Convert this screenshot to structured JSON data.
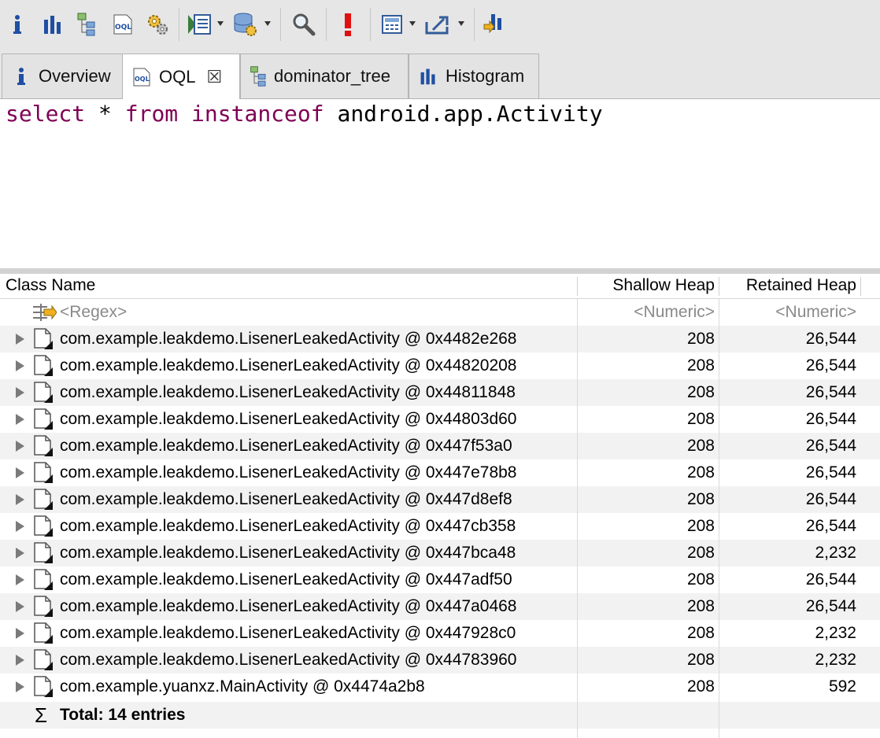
{
  "toolbar": {
    "buttons": [
      {
        "name": "info-icon",
        "dropdown": false
      },
      {
        "name": "histogram-icon",
        "dropdown": false
      },
      {
        "name": "dominator-tree-icon",
        "dropdown": false
      },
      {
        "name": "oql-icon",
        "dropdown": false
      },
      {
        "name": "gears-icon",
        "dropdown": false
      },
      {
        "name": "report-icon",
        "dropdown": true
      },
      {
        "name": "database-query-icon",
        "dropdown": true
      },
      {
        "name": "search-icon",
        "dropdown": false
      },
      {
        "name": "alert-icon",
        "dropdown": false
      },
      {
        "name": "calculator-icon",
        "dropdown": true
      },
      {
        "name": "export-icon",
        "dropdown": true
      },
      {
        "name": "heap-dump-icon",
        "dropdown": false
      }
    ],
    "oql_icon_text": "OQL"
  },
  "tabs": [
    {
      "label": "Overview",
      "icon": "info-icon",
      "active": false
    },
    {
      "label": "OQL",
      "icon": "oql-icon",
      "active": true,
      "close": "☒"
    },
    {
      "label": "dominator_tree",
      "icon": "dominator-tree-icon",
      "active": false
    },
    {
      "label": "Histogram",
      "icon": "histogram-icon",
      "active": false
    }
  ],
  "query": {
    "kw1": "select",
    "p1": " * ",
    "kw2": "from",
    "p2": " ",
    "kw3": "instanceof",
    "p3": " android.app.Activity"
  },
  "table": {
    "columns": [
      "Class Name",
      "Shallow Heap",
      "Retained Heap"
    ],
    "filters": {
      "name": "<Regex>",
      "shallow": "<Numeric>",
      "retained": "<Numeric>"
    },
    "rows": [
      {
        "name": "com.example.leakdemo.LisenerLeakedActivity @ 0x4482e268",
        "shallow": "208",
        "retained": "26,544"
      },
      {
        "name": "com.example.leakdemo.LisenerLeakedActivity @ 0x44820208",
        "shallow": "208",
        "retained": "26,544"
      },
      {
        "name": "com.example.leakdemo.LisenerLeakedActivity @ 0x44811848",
        "shallow": "208",
        "retained": "26,544"
      },
      {
        "name": "com.example.leakdemo.LisenerLeakedActivity @ 0x44803d60",
        "shallow": "208",
        "retained": "26,544"
      },
      {
        "name": "com.example.leakdemo.LisenerLeakedActivity @ 0x447f53a0",
        "shallow": "208",
        "retained": "26,544"
      },
      {
        "name": "com.example.leakdemo.LisenerLeakedActivity @ 0x447e78b8",
        "shallow": "208",
        "retained": "26,544"
      },
      {
        "name": "com.example.leakdemo.LisenerLeakedActivity @ 0x447d8ef8",
        "shallow": "208",
        "retained": "26,544"
      },
      {
        "name": "com.example.leakdemo.LisenerLeakedActivity @ 0x447cb358",
        "shallow": "208",
        "retained": "26,544"
      },
      {
        "name": "com.example.leakdemo.LisenerLeakedActivity @ 0x447bca48",
        "shallow": "208",
        "retained": "2,232"
      },
      {
        "name": "com.example.leakdemo.LisenerLeakedActivity @ 0x447adf50",
        "shallow": "208",
        "retained": "26,544"
      },
      {
        "name": "com.example.leakdemo.LisenerLeakedActivity @ 0x447a0468",
        "shallow": "208",
        "retained": "26,544"
      },
      {
        "name": "com.example.leakdemo.LisenerLeakedActivity @ 0x447928c0",
        "shallow": "208",
        "retained": "2,232"
      },
      {
        "name": "com.example.leakdemo.LisenerLeakedActivity @ 0x44783960",
        "shallow": "208",
        "retained": "2,232"
      },
      {
        "name": "com.example.yuanxz.MainActivity @ 0x4474a2b8",
        "shallow": "208",
        "retained": "592"
      }
    ],
    "total": {
      "symbol": "Σ",
      "label": "Total: 14 entries"
    }
  }
}
